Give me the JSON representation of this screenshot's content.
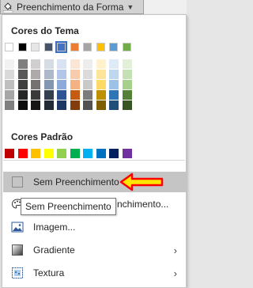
{
  "toolbar": {
    "button_label": "Preenchimento da Forma",
    "button_icon": "paint-bucket-icon"
  },
  "menu": {
    "theme_title": "Cores do Tema",
    "standard_title": "Cores Padrão",
    "theme_top_colors": [
      "#FFFFFF",
      "#000000",
      "#E7E6E6",
      "#44546A",
      "#4472C4",
      "#ED7D31",
      "#A5A5A5",
      "#FFC000",
      "#5B9BD5",
      "#70AD47"
    ],
    "theme_shades": [
      [
        "#F2F2F2",
        "#D9D9D9",
        "#BFBFBF",
        "#A6A6A6",
        "#808080"
      ],
      [
        "#7F7F7F",
        "#595959",
        "#404040",
        "#262626",
        "#0D0D0D"
      ],
      [
        "#D0CECE",
        "#AEAAAA",
        "#757171",
        "#3A3838",
        "#171616"
      ],
      [
        "#D6DCE4",
        "#ADB9CA",
        "#8497B0",
        "#333F4F",
        "#222A35"
      ],
      [
        "#D9E2F3",
        "#B4C6E7",
        "#8EAADB",
        "#2F5496",
        "#1F3864"
      ],
      [
        "#FBE5D5",
        "#F7CBAC",
        "#F4B183",
        "#C55A11",
        "#833C0B"
      ],
      [
        "#EDEDED",
        "#DBDBDB",
        "#C9C9C9",
        "#7B7B7B",
        "#525252"
      ],
      [
        "#FFF2CC",
        "#FEE599",
        "#FFD965",
        "#BF9000",
        "#7F6000"
      ],
      [
        "#DEEBF6",
        "#BDD7EE",
        "#9CC3E5",
        "#2E75B5",
        "#1F4E79"
      ],
      [
        "#E2EFD9",
        "#C5E0B3",
        "#A8D08D",
        "#538135",
        "#375623"
      ]
    ],
    "standard_colors": [
      "#C00000",
      "#FF0000",
      "#FFC000",
      "#FFFF00",
      "#92D050",
      "#00B050",
      "#00B0F0",
      "#0070C0",
      "#002060",
      "#7030A0"
    ],
    "selected_theme_color_index": 4,
    "items": [
      {
        "label": "Sem Preenchimento",
        "icon": "no-fill-icon",
        "submenu": false
      },
      {
        "label": "Mais Cores de Preenchimento...",
        "icon": "color-palette-icon",
        "submenu": false
      },
      {
        "label": "Imagem...",
        "icon": "picture-icon",
        "submenu": false
      },
      {
        "label": "Gradiente",
        "icon": "gradient-icon",
        "submenu": true
      },
      {
        "label": "Textura",
        "icon": "texture-icon",
        "submenu": true
      }
    ],
    "visible_partial_label": "nchimento...",
    "submenu_arrow": "›"
  },
  "tooltip": {
    "text": "Sem Preenchimento"
  },
  "annotation": {
    "arrow_color": "#FF0000",
    "arrow_fill": "#FFE600"
  }
}
